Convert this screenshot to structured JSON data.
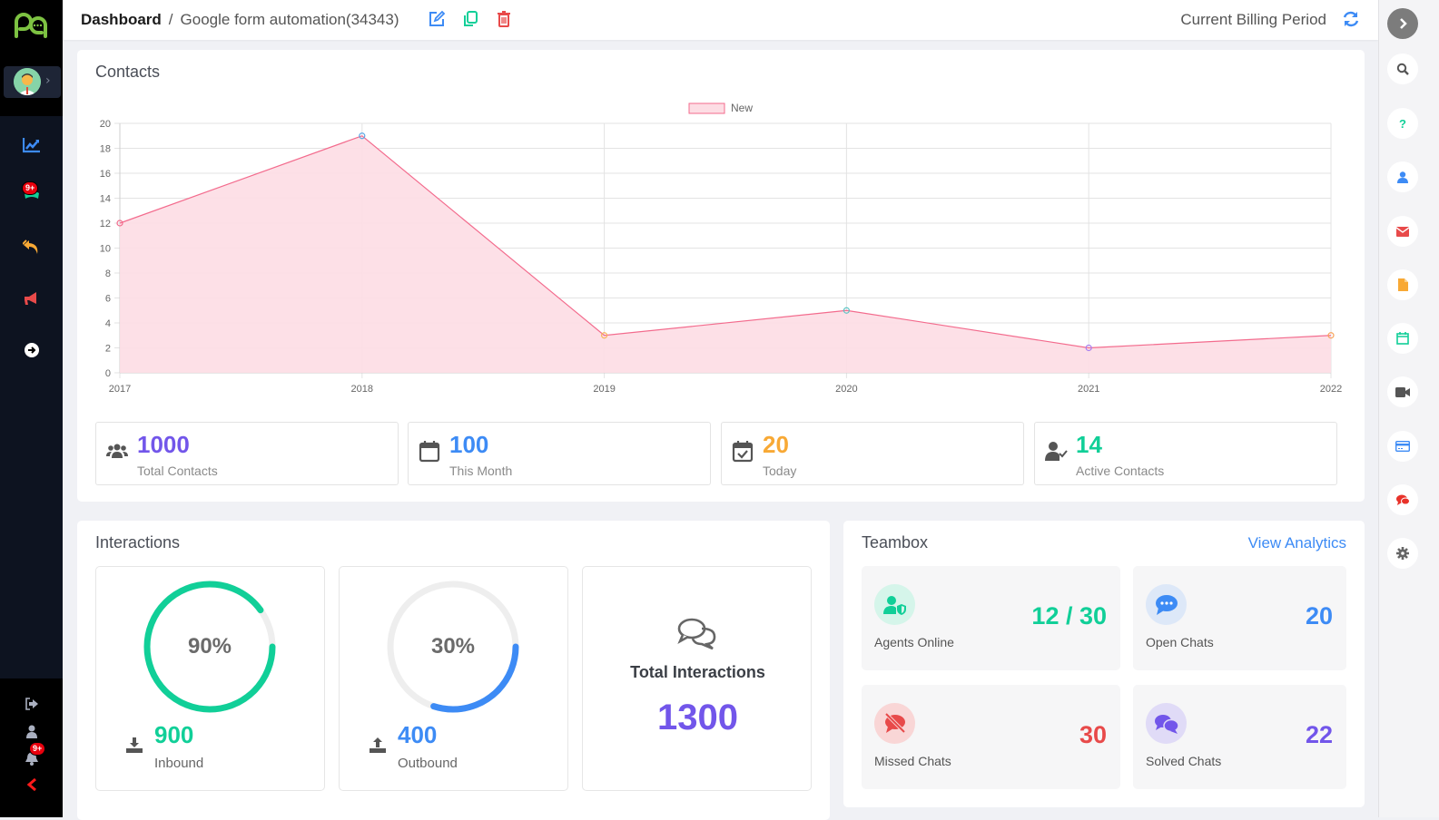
{
  "colors": {
    "purple": "#7256ea",
    "blue": "#3d8bf5",
    "orange": "#f8a935",
    "green": "#11cf98",
    "red": "#e84a4a",
    "chart_line": "#f36b8d",
    "chart_fill": "#fddde4"
  },
  "sidebar": {
    "logo": "pa-logo",
    "items": [
      {
        "icon": "chart-line-icon",
        "label": "Analytics"
      },
      {
        "icon": "chat-icon",
        "label": "Chats",
        "badge": "9+"
      },
      {
        "icon": "reply-all-icon",
        "label": "Replies"
      },
      {
        "icon": "megaphone-icon",
        "label": "Campaigns"
      },
      {
        "icon": "arrow-circle-right-icon",
        "label": "Go"
      }
    ],
    "bottom": [
      {
        "icon": "logout-icon"
      },
      {
        "icon": "user-icon"
      },
      {
        "icon": "bell-icon",
        "badge": "9+"
      },
      {
        "icon": "chevron-left-icon"
      }
    ]
  },
  "header": {
    "breadcrumb_home": "Dashboard",
    "breadcrumb_sep": "/",
    "breadcrumb_current": "Google form automation(34343)",
    "billing_label": "Current Billing Period"
  },
  "contacts": {
    "title": "Contacts",
    "stats": [
      {
        "icon": "users-icon",
        "value": "1000",
        "label": "Total Contacts",
        "color": "#7256ea"
      },
      {
        "icon": "calendar-icon",
        "value": "100",
        "label": "This Month",
        "color": "#3d8bf5"
      },
      {
        "icon": "calendar-check-icon",
        "value": "20",
        "label": "Today",
        "color": "#f8a935"
      },
      {
        "icon": "user-check-icon",
        "value": "14",
        "label": "Active Contacts",
        "color": "#11cf98"
      }
    ]
  },
  "chart_data": {
    "type": "area",
    "title": "",
    "xlabel": "",
    "ylabel": "",
    "categories": [
      "2017",
      "2018",
      "2019",
      "2020",
      "2021",
      "2022"
    ],
    "series": [
      {
        "name": "New",
        "values": [
          12,
          19,
          3,
          5,
          2,
          3
        ]
      }
    ],
    "point_colors": [
      "#f36b8d",
      "#5aa7e6",
      "#f8b35a",
      "#5cc4c4",
      "#a77ef0",
      "#f8a35a"
    ],
    "ylim": [
      0,
      20
    ],
    "yticks": [
      "0",
      "2",
      "4",
      "6",
      "8",
      "10",
      "12",
      "14",
      "16",
      "18",
      "20"
    ],
    "grid": true,
    "legend": "top-center"
  },
  "interactions": {
    "title": "Interactions",
    "inbound": {
      "percent": 90,
      "percent_label": "90%",
      "value": "900",
      "label": "Inbound"
    },
    "outbound": {
      "percent": 30,
      "percent_label": "30%",
      "value": "400",
      "label": "Outbound"
    },
    "total": {
      "label": "Total Interactions",
      "value": "1300"
    }
  },
  "teambox": {
    "title": "Teambox",
    "link": "View Analytics",
    "tiles": [
      {
        "label": "Agents Online",
        "value": "12 / 30",
        "color": "#11cf98",
        "bg": "#d5f5ea"
      },
      {
        "label": "Open Chats",
        "value": "20",
        "color": "#3d8bf5",
        "bg": "#dde8f8"
      },
      {
        "label": "Missed Chats",
        "value": "30",
        "color": "#e84a4a",
        "bg": "#f9d6d6"
      },
      {
        "label": "Solved Chats",
        "value": "22",
        "color": "#7256ea",
        "bg": "#e0dbf7"
      }
    ]
  },
  "right_rail": [
    "expand-icon",
    "search-icon",
    "help-icon",
    "contact-icon",
    "email-icon",
    "document-icon",
    "calendar-icon",
    "video-icon",
    "credit-card-icon",
    "comments-icon",
    "settings-icon"
  ]
}
